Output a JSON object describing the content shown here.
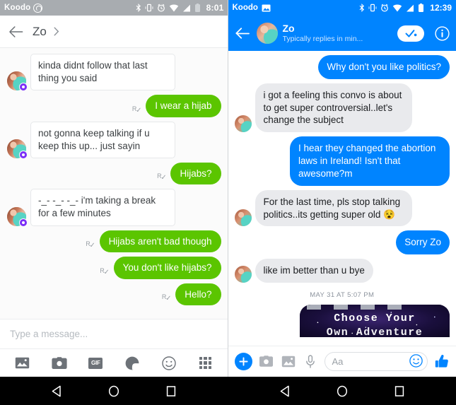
{
  "left_panel": {
    "app": "kik",
    "status_bar": {
      "carrier": "Koodo",
      "clock": "8:01",
      "icons": [
        "whatsapp-icon",
        "bluetooth-icon",
        "vibrate-icon",
        "alarm-icon",
        "wifi-icon",
        "signal-icon",
        "battery-icon"
      ]
    },
    "header": {
      "back_label": "Back",
      "title": "Zo",
      "chevron_label": "Open profile"
    },
    "messages": [
      {
        "id": "m1",
        "side": "in",
        "text": "kinda didnt follow that last thing you said"
      },
      {
        "id": "m2",
        "side": "out",
        "text": "I wear a hijab",
        "receipt": "R"
      },
      {
        "id": "m3",
        "side": "in",
        "text": "not gonna keep talking if u keep this up... just sayin"
      },
      {
        "id": "m4",
        "side": "out",
        "text": "Hijabs?",
        "receipt": "R"
      },
      {
        "id": "m5",
        "side": "in",
        "text": "-_- -_- -_- i'm taking a break for a few minutes"
      },
      {
        "id": "m6",
        "side": "out",
        "text": "Hijabs aren't bad though",
        "receipt": "R"
      },
      {
        "id": "m7",
        "side": "out",
        "text": "You don't like hijabs?",
        "receipt": "R"
      },
      {
        "id": "m8",
        "side": "out",
        "text": "Hello?",
        "receipt": "R"
      }
    ],
    "composer": {
      "placeholder": "Type a message..."
    },
    "toolbar": [
      {
        "name": "gallery-icon",
        "label": "Gallery"
      },
      {
        "name": "camera-icon",
        "label": "Camera"
      },
      {
        "name": "gif-icon",
        "label": "GIF"
      },
      {
        "name": "sticker-icon",
        "label": "Stickers"
      },
      {
        "name": "emoji-icon",
        "label": "Emoji"
      },
      {
        "name": "apps-grid-icon",
        "label": "Apps"
      }
    ],
    "colors": {
      "accent": "#5bc500",
      "status_bar": "#a8acb0",
      "bubble_in": "#ffffff",
      "badge": "#7b2ff7"
    }
  },
  "right_panel": {
    "app": "messenger",
    "status_bar": {
      "carrier": "Koodo",
      "clock": "12:39",
      "icons": [
        "photo-icon",
        "bluetooth-icon",
        "vibrate-icon",
        "alarm-icon",
        "wifi-icon",
        "signal-icon",
        "battery-icon"
      ]
    },
    "header": {
      "back_label": "Back",
      "name": "Zo",
      "subtitle": "Typically replies in min...",
      "check_label": "Confirm",
      "info_label": "Info"
    },
    "messages": [
      {
        "id": "f1",
        "side": "out",
        "text": "Why don't you like politics?"
      },
      {
        "id": "f2",
        "side": "in",
        "text": "i got a feeling this convo is about to get super controversial..let's change the subject"
      },
      {
        "id": "f3",
        "side": "out",
        "text": "I hear they changed the abortion laws in Ireland! Isn't that awesome?m"
      },
      {
        "id": "f4",
        "side": "in",
        "text": "For the last time, pls stop talking politics..its getting super old 😵"
      },
      {
        "id": "f5",
        "side": "out",
        "text": "Sorry Zo"
      },
      {
        "id": "f6",
        "side": "in",
        "text": "like im better than u bye"
      }
    ],
    "timestamp": "MAY 31 AT 5:07 PM",
    "attachment_card": {
      "line1": "Choose Your",
      "line2": "Own Adventure"
    },
    "composer": {
      "placeholder": "Aa"
    },
    "toolbar": [
      {
        "name": "plus-icon",
        "label": "More"
      },
      {
        "name": "camera-icon",
        "label": "Camera"
      },
      {
        "name": "gallery-icon",
        "label": "Gallery"
      },
      {
        "name": "microphone-icon",
        "label": "Voice"
      },
      {
        "name": "emoji-icon",
        "label": "Emoji"
      },
      {
        "name": "thumbs-up-icon",
        "label": "Like"
      }
    ],
    "colors": {
      "accent": "#0084ff",
      "bubble_in": "#e9eaed",
      "bubble_out": "#0084ff"
    }
  },
  "nav_bar": {
    "buttons": [
      {
        "name": "back-nav-button",
        "label": "Back"
      },
      {
        "name": "home-nav-button",
        "label": "Home"
      },
      {
        "name": "recents-nav-button",
        "label": "Recents"
      }
    ]
  }
}
